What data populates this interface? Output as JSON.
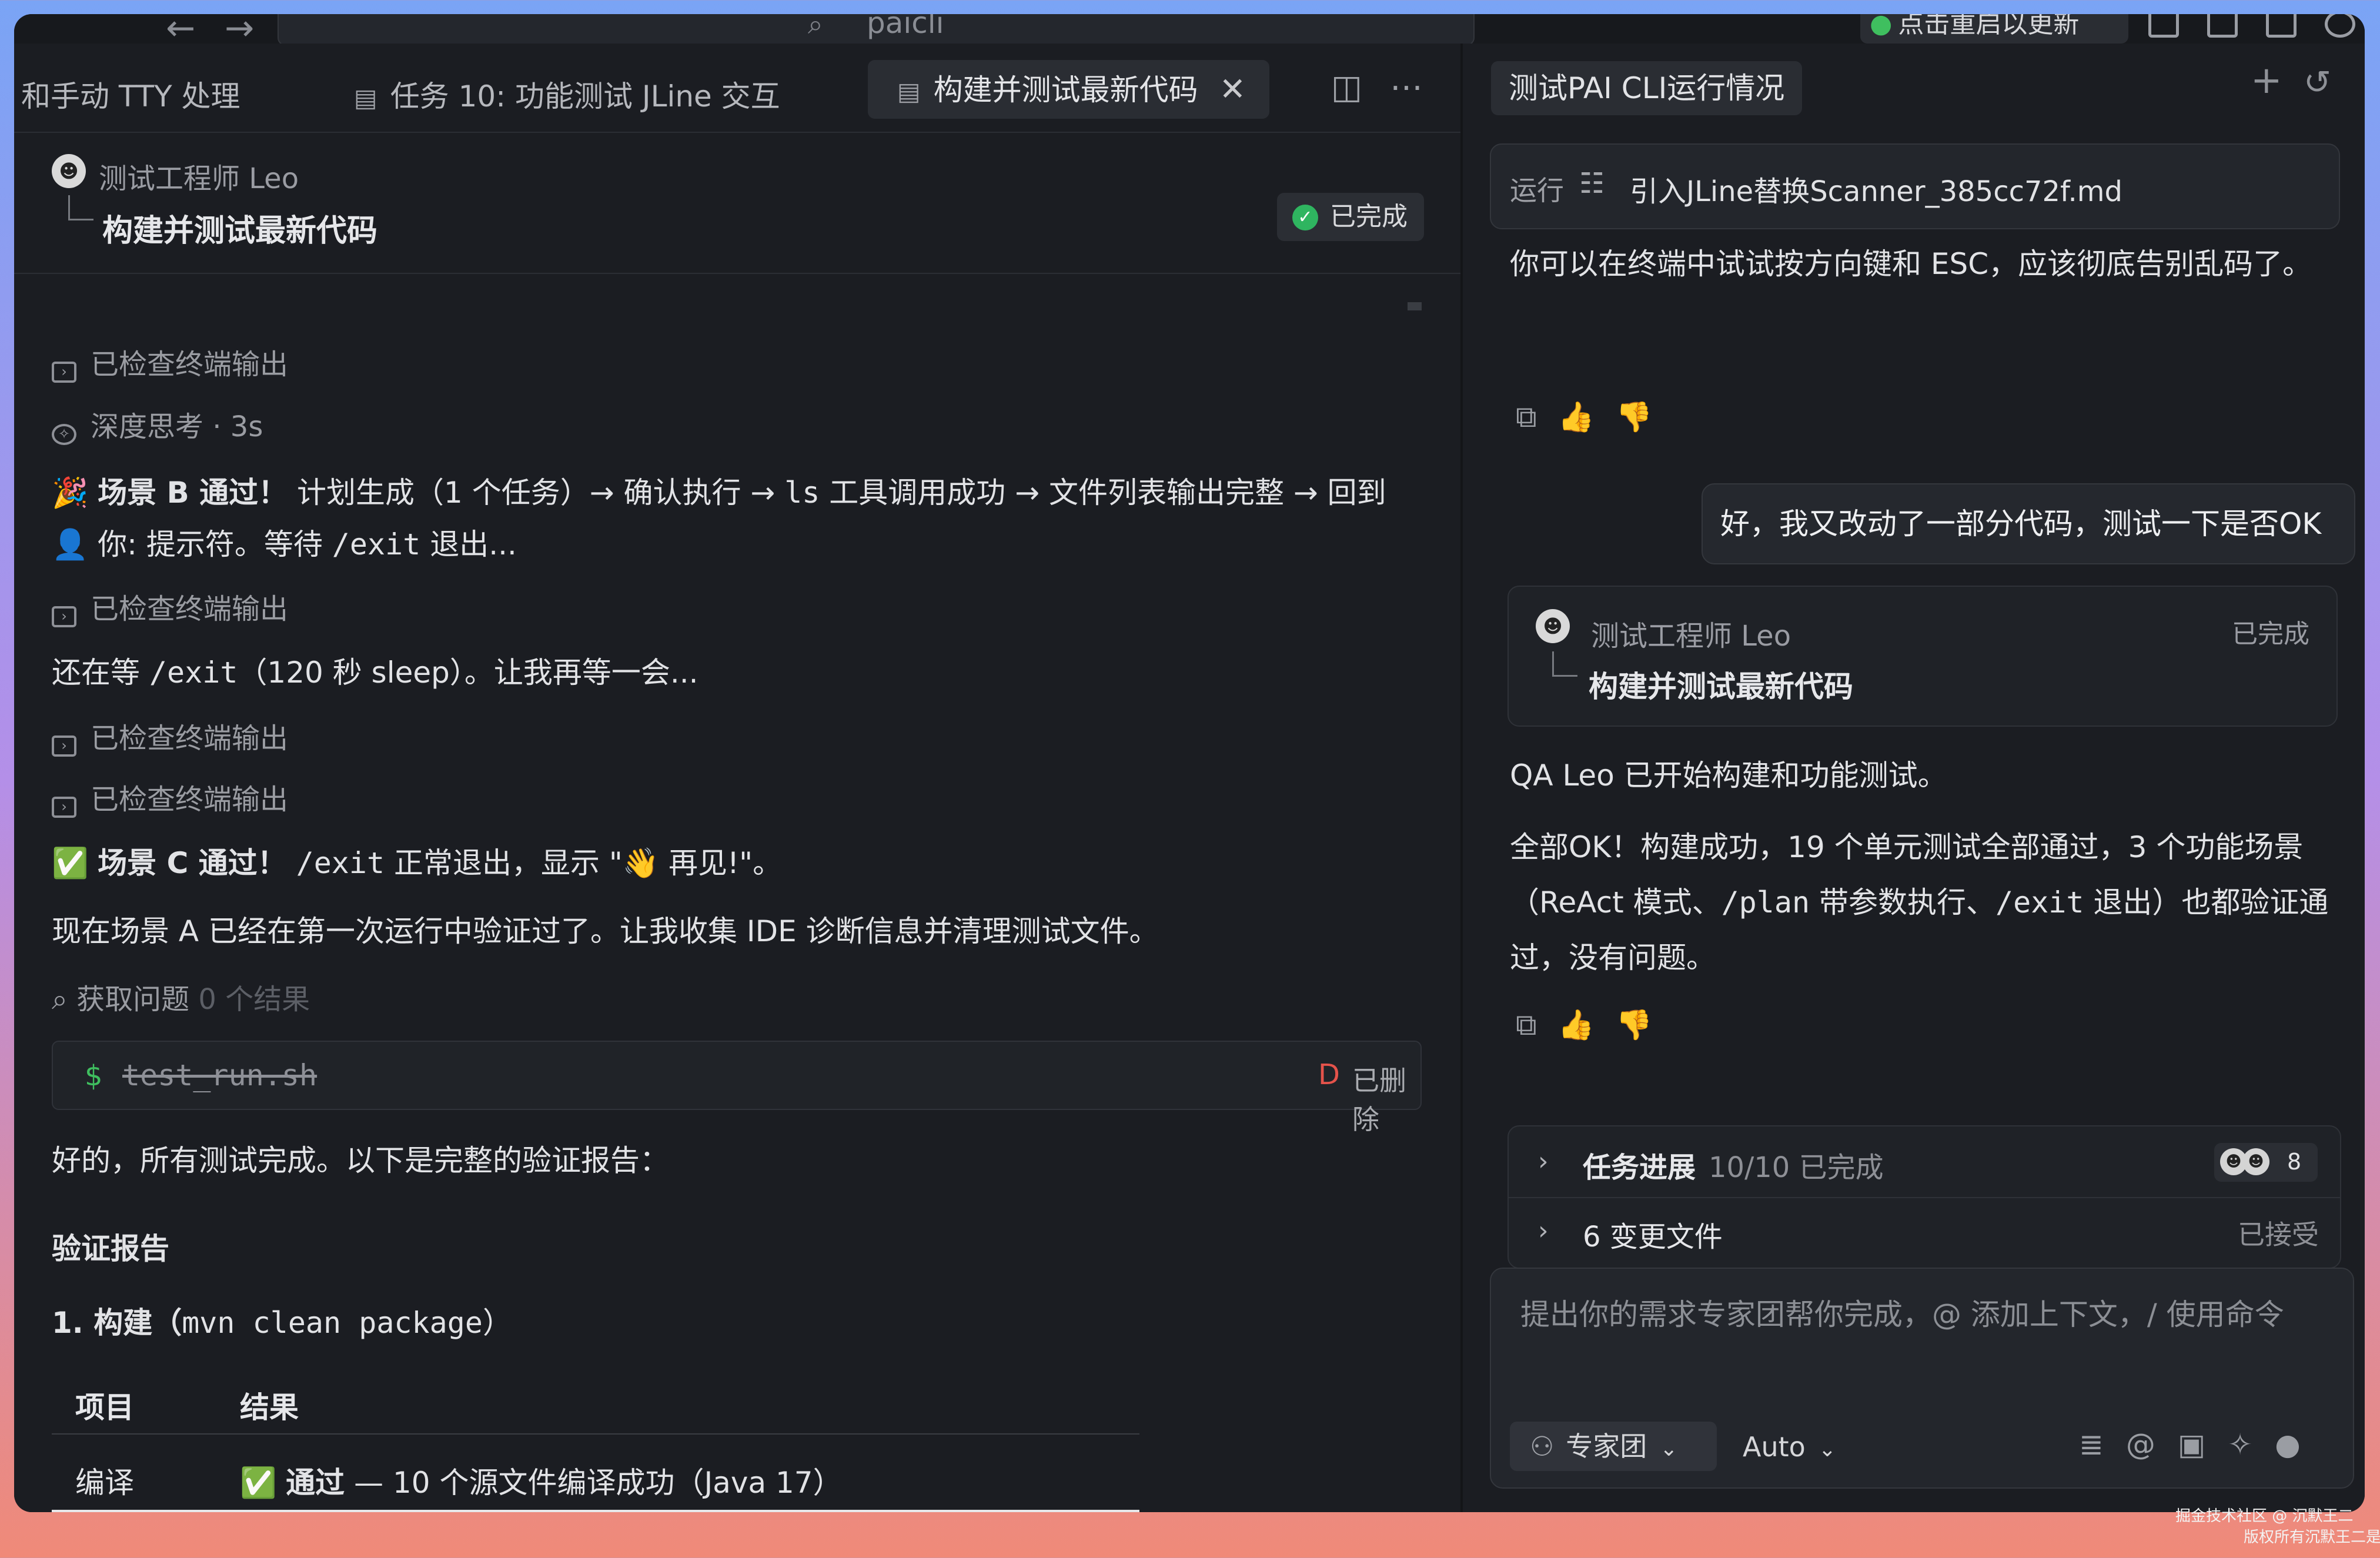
{
  "titlebar": {
    "search_text": "paicli",
    "update_label": "点击重启以更新",
    "back_icon": "arrow-left-icon",
    "forward_icon": "arrow-right-icon"
  },
  "tabs": [
    {
      "label": "和手动 TTY 处理",
      "active": false
    },
    {
      "label": "任务 10: 功能测试 JLine 交互",
      "active": false
    },
    {
      "label": "构建并测试最新代码",
      "active": true
    }
  ],
  "task_header": {
    "agent_name": "测试工程师 Leo",
    "task_title": "构建并测试最新代码",
    "status": "已完成"
  },
  "content": {
    "checked_terminal": "已检查终端输出",
    "deep_think": "深度思考 · 3s",
    "scenario_b": {
      "emoji": "🎉",
      "title": "场景 B 通过！",
      "text1": " 计划生成（1 个任务）→ 确认执行 → ",
      "code1": "ls",
      "text2": " 工具调用成功 → 文件列表输出完整 → 回到",
      "line2_pre": "👤 你: 提示符。等待 ",
      "line2_code": "/exit",
      "line2_post": " 退出..."
    },
    "waiting": {
      "pre": "还在等 ",
      "code": "/exit",
      "post": "（120 秒 sleep）。让我再等一会..."
    },
    "scenario_c": {
      "emoji": "✅",
      "title": "场景 C 通过！",
      "code": "/exit",
      "text": " 正常退出，显示 \"👋 再见!\"。"
    },
    "scenario_a": "现在场景 A 已经在第一次运行中验证过了。让我收集 IDE 诊断信息并清理测试文件。",
    "get_issues": {
      "label": "获取问题",
      "result": "0 个结果"
    },
    "file": {
      "prompt": "$",
      "name": "test_run.sh",
      "flag": "D",
      "status": "已删除"
    },
    "all_done": "好的，所有测试完成。以下是完整的验证报告：",
    "report_title": "验证报告",
    "section1": {
      "pre": "1. 构建（",
      "code": "mvn clean package",
      "post": "）"
    },
    "table": {
      "headers": [
        "项目",
        "结果"
      ],
      "rows": [
        {
          "item": "编译",
          "result_icon": "✅",
          "result_bold": "通过",
          "result_text": " — 10 个源文件编译成功（Java 17）"
        }
      ]
    }
  },
  "right": {
    "chat_title": "测试PAI CLI运行情况",
    "run_label": "运行",
    "run_file": "引入JLine替换Scanner_385cc72f.md",
    "msg1": "你可以在终端中试试按方向键和 ESC，应该彻底告别乱码了。",
    "user_msg": "好，我又改动了一部分代码，测试一下是否OK",
    "agent_card": {
      "name": "测试工程师 Leo",
      "status": "已完成",
      "title": "构建并测试最新代码"
    },
    "msg2": "QA Leo 已开始构建和功能测试。",
    "msg3": {
      "l1": "全部OK！构建成功，19 个单元测试全部通过，3 个功能场景",
      "l2_pre": "（ReAct 模式、",
      "l2_code1": "/plan",
      "l2_mid": " 带参数执行、",
      "l2_code2": "/exit",
      "l2_post": " 退出）也都验证通",
      "l3": "过，没有问题。"
    },
    "progress": {
      "label": "任务进展",
      "sub": "10/10 已完成",
      "count": "8"
    },
    "changes": {
      "label": "6 变更文件",
      "status": "已接受"
    },
    "input_placeholder": "提出你的需求专家团帮你完成，@ 添加上下文，/ 使用命令",
    "team_label": "专家团",
    "mode_label": "Auto"
  },
  "watermark": {
    "line1": "掘金技术社区 @ 沉默王二",
    "line2": "版权所有沉默王二是系列"
  }
}
